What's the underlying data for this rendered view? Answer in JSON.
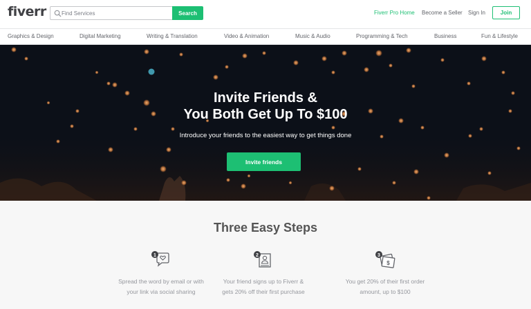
{
  "header": {
    "logo": "fiverr",
    "search_placeholder": "Find Services",
    "search_button": "Search",
    "pro_link": "Fiverr Pro Home",
    "seller_link": "Become a Seller",
    "signin_link": "Sign In",
    "join_button": "Join"
  },
  "categories": [
    "Graphics & Design",
    "Digital Marketing",
    "Writing & Translation",
    "Video & Animation",
    "Music & Audio",
    "Programming & Tech",
    "Business",
    "Fun & Lifestyle"
  ],
  "hero": {
    "title_line1": "Invite Friends &",
    "title_line2": "You Both Get Up To $100",
    "subtitle": "Introduce your friends to the easiest way to get things done",
    "button": "Invite friends"
  },
  "steps": {
    "title": "Three Easy Steps",
    "items": [
      {
        "number": "1",
        "icon": "share-bubble-icon",
        "line1": "Spread the word by email or with",
        "line2": "your link via social sharing"
      },
      {
        "number": "2",
        "icon": "signup-profile-icon",
        "line1": "Your friend signs up to Fiverr &",
        "line2": "gets 20% off their first purchase"
      },
      {
        "number": "3",
        "icon": "money-reward-icon",
        "line1": "You get 20% of their first order",
        "line2": "amount, up to $100"
      }
    ]
  },
  "colors": {
    "brand_green": "#1dbf73",
    "hero_background": "#0c1018",
    "bokeh_light": "#e8a060"
  }
}
